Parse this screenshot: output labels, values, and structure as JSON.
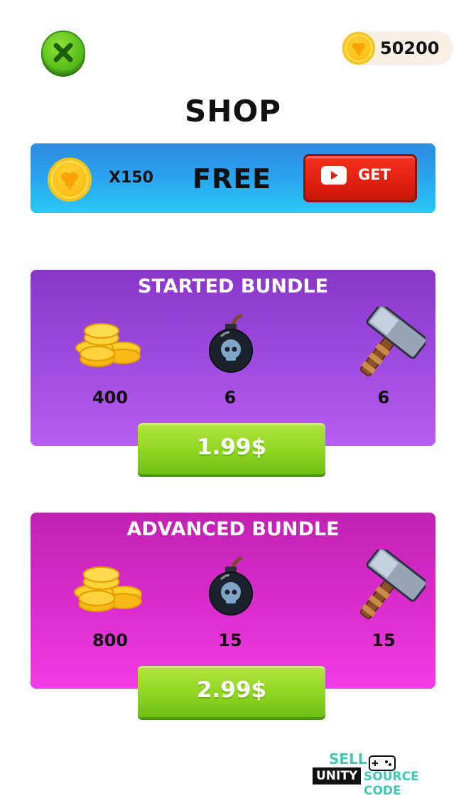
{
  "header": {
    "close_icon": "close-x-icon",
    "coin_icon": "clover-coin-icon",
    "coin_balance": "50200"
  },
  "title": "SHOP",
  "free_offer": {
    "coin_icon": "clover-coin-icon",
    "multiplier": "X150",
    "label": "FREE",
    "button_icon": "youtube-play-icon",
    "button_label": "GET"
  },
  "bundles": [
    {
      "title": "STARTED BUNDLE",
      "items": [
        {
          "icon": "gold-coins-stack-icon",
          "quantity": "400"
        },
        {
          "icon": "skull-bomb-icon",
          "quantity": "6"
        },
        {
          "icon": "hammer-icon",
          "quantity": "6"
        }
      ],
      "price": "1.99$"
    },
    {
      "title": "ADVANCED BUNDLE",
      "items": [
        {
          "icon": "gold-coins-stack-icon",
          "quantity": "800"
        },
        {
          "icon": "skull-bomb-icon",
          "quantity": "15"
        },
        {
          "icon": "hammer-icon",
          "quantity": "15"
        }
      ],
      "price": "2.99$"
    }
  ],
  "watermark": {
    "line1": "SELL",
    "badge": "UNITY",
    "line2": "SOURCE CODE"
  },
  "colors": {
    "close_green": "#5fc21d",
    "banner_blue": "#2aa4ef",
    "get_red": "#e0200f",
    "started_purple": "#a14ce0",
    "advanced_magenta": "#db2dce",
    "buy_green": "#8fd522"
  }
}
